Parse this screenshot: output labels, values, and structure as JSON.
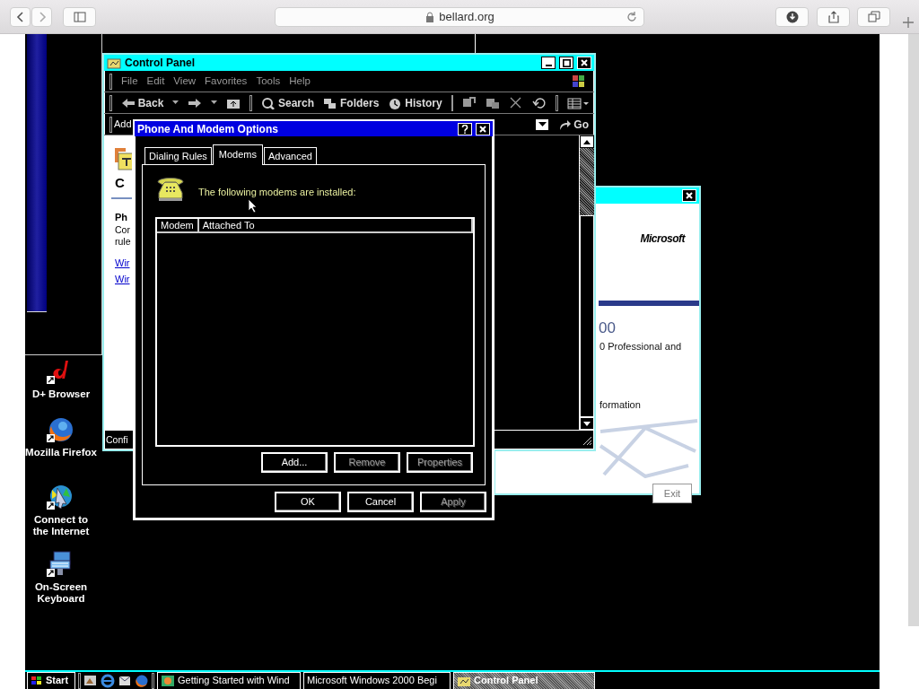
{
  "browser": {
    "url": "bellard.org"
  },
  "desktop_icons": [
    {
      "kind": "dplus",
      "label": "D+ Browser"
    },
    {
      "kind": "firefox",
      "label": "Mozilla Firefox"
    },
    {
      "kind": "connect",
      "label": "Connect to the Internet"
    },
    {
      "kind": "keyboard",
      "label": "On-Screen Keyboard"
    }
  ],
  "control_panel": {
    "title": "Control Panel",
    "menu": [
      "File",
      "Edit",
      "View",
      "Favorites",
      "Tools",
      "Help"
    ],
    "toolbar": [
      {
        "kind": "back",
        "label": "Back"
      },
      {
        "kind": "search",
        "label": "Search"
      },
      {
        "kind": "folders",
        "label": "Folders"
      },
      {
        "kind": "history",
        "label": "History"
      }
    ],
    "address_label": "Add",
    "go": "Go",
    "heading": "C",
    "section_title": "Ph",
    "lines": [
      "Cor",
      "rule"
    ],
    "links": [
      "Wir",
      "Wir"
    ],
    "status": "Confi"
  },
  "getting_started": {
    "logo": "Microsoft",
    "big_text": "00",
    "line": "0 Professional and",
    "link_text": "formation",
    "exit": "Exit"
  },
  "dialog": {
    "title": "Phone And Modem Options",
    "tabs": [
      {
        "label": "Dialing Rules",
        "selected": false
      },
      {
        "label": "Modems",
        "selected": true
      },
      {
        "label": "Advanced",
        "selected": false
      }
    ],
    "message": "The following modems are installed:",
    "columns": [
      "Modem",
      "Attached To"
    ],
    "list_buttons": [
      {
        "label": "Add...",
        "disabled": false
      },
      {
        "label": "Remove",
        "disabled": true
      },
      {
        "label": "Properties",
        "disabled": true
      }
    ],
    "buttons": [
      {
        "label": "OK",
        "disabled": false
      },
      {
        "label": "Cancel",
        "disabled": false
      },
      {
        "label": "Apply",
        "disabled": true
      }
    ]
  },
  "taskbar": {
    "start": "Start",
    "quick_launch": [
      {
        "kind": "desktop"
      },
      {
        "kind": "ie"
      },
      {
        "kind": "outlook"
      },
      {
        "kind": "firefox"
      }
    ],
    "tasks": [
      {
        "label": "Getting Started with Wind",
        "selected": false
      },
      {
        "label": "Microsoft Windows 2000 Begi",
        "selected": false
      },
      {
        "label": "Control Panel",
        "selected": true
      }
    ]
  }
}
